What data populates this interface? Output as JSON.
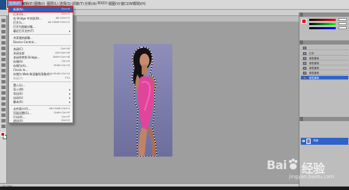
{
  "menubar": {
    "items": [
      "文件(F)",
      "编辑(E)",
      "图像(I)",
      "图层(L)",
      "选择(S)",
      "滤镜(T)",
      "分析(A)",
      "3D(D)",
      "视图(V)",
      "窗口(W)",
      "帮助(H)"
    ]
  },
  "file_menu": {
    "items": [
      {
        "label": "新建(N)...",
        "shortcut": "Ctrl+N"
      },
      {
        "label": "打开(O)...",
        "shortcut": "Ctrl+O"
      },
      {
        "label": "在 Bridge 中浏览(B)...",
        "shortcut": "Alt+Ctrl+O"
      },
      {
        "label": "打开为...",
        "shortcut": "Alt+Shift+Ctrl+O"
      },
      {
        "label": "打开为智能对象...",
        "shortcut": ""
      },
      {
        "label": "最近打开文件(T)",
        "shortcut": ""
      },
      {
        "label": "共享我的屏幕...",
        "shortcut": ""
      },
      {
        "label": "Device Central...",
        "shortcut": ""
      },
      {
        "label": "关闭(C)",
        "shortcut": "Ctrl+W"
      },
      {
        "label": "关闭全部",
        "shortcut": "Alt+Ctrl+W"
      },
      {
        "label": "关闭并转到 Bridge...",
        "shortcut": "Shift+Ctrl+W"
      },
      {
        "label": "存储(S)",
        "shortcut": "Ctrl+S"
      },
      {
        "label": "存储为(A)...",
        "shortcut": "Shift+Ctrl+S"
      },
      {
        "label": "Check In...",
        "shortcut": ""
      },
      {
        "label": "存储为 Web 和设备所用格式...",
        "shortcut": "Alt+Shift+Ctrl+S"
      },
      {
        "label": "恢复(V)",
        "shortcut": "F12"
      },
      {
        "label": "置入(L)...",
        "shortcut": ""
      },
      {
        "label": "导入(M)",
        "shortcut": ""
      },
      {
        "label": "导出(E)",
        "shortcut": ""
      },
      {
        "label": "自动(U)",
        "shortcut": ""
      },
      {
        "label": "脚本(R)",
        "shortcut": ""
      },
      {
        "label": "文件简介(F)...",
        "shortcut": "Alt+Shift+Ctrl+I"
      },
      {
        "label": "页面设置(G)...",
        "shortcut": "Shift+Ctrl+P"
      },
      {
        "label": "打印(P)...",
        "shortcut": "Ctrl+P"
      },
      {
        "label": "打印一份(Y)",
        "shortcut": "Alt+Shift+Ctrl+P"
      },
      {
        "label": "退出(X)",
        "shortcut": "Ctrl+Q"
      }
    ]
  },
  "status": {
    "zoom": "33.33%"
  },
  "panels": {
    "history_rows": [
      "打开",
      "磁性套索",
      "磁性套索",
      "磁性套索",
      "磁性套索",
      "磁性套索",
      "磁性套索"
    ],
    "layer_name": "背景"
  },
  "watermark": {
    "brand": "Bai",
    "brand2": "经验",
    "sub": "jingyan.baidu.com"
  },
  "colors": {
    "foreground": "#e3141b",
    "background": "#ffffff",
    "selection": "#2f5fc1"
  }
}
